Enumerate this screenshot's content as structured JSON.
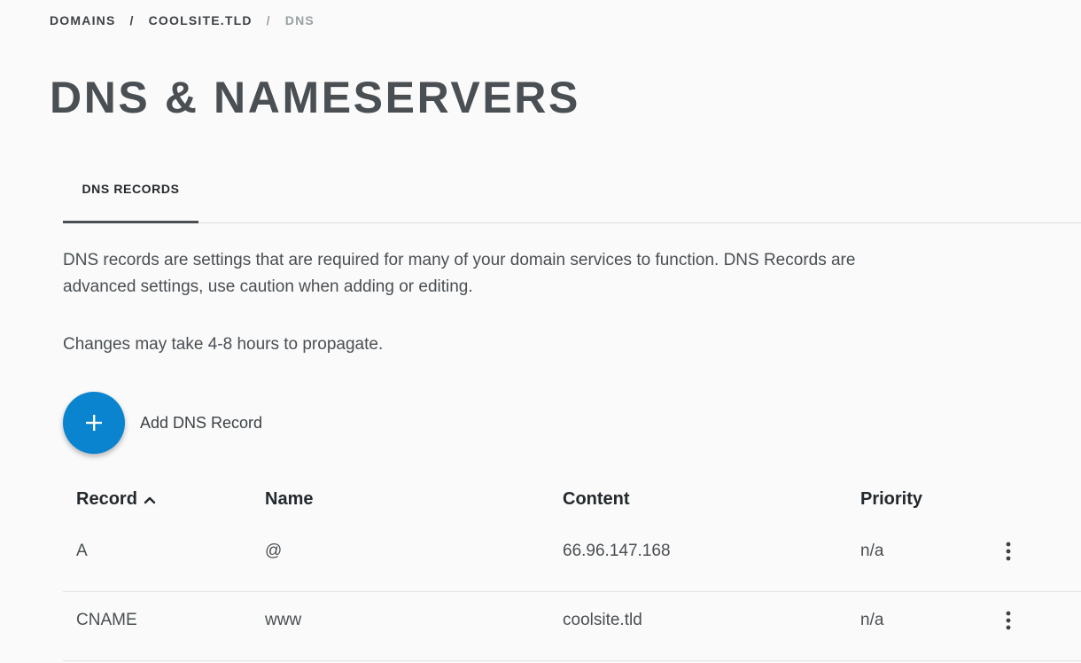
{
  "breadcrumb": {
    "items": [
      "DOMAINS",
      "COOLSITE.TLD",
      "DNS"
    ],
    "separator": "/"
  },
  "page": {
    "title": "DNS & NAMESERVERS"
  },
  "tabs": [
    {
      "label": "DNS RECORDS",
      "active": true
    }
  ],
  "content": {
    "description": "DNS records are settings that are required for many of your domain services to function. DNS Records are advanced settings, use caution when adding or editing.",
    "note": "Changes may take 4-8 hours to propagate."
  },
  "add_button": {
    "label": "Add DNS Record",
    "icon": "plus-icon",
    "color": "#0a84cf"
  },
  "table": {
    "columns": {
      "record": "Record",
      "name": "Name",
      "content": "Content",
      "priority": "Priority"
    },
    "sort": {
      "column": "record",
      "direction": "asc",
      "icon": "chevron-up-icon"
    },
    "rows": [
      {
        "record": "A",
        "name": "@",
        "content": "66.96.147.168",
        "priority": "n/a"
      },
      {
        "record": "CNAME",
        "name": "www",
        "content": "coolsite.tld",
        "priority": "n/a"
      }
    ],
    "row_menu_icon": "more-vertical-icon"
  }
}
